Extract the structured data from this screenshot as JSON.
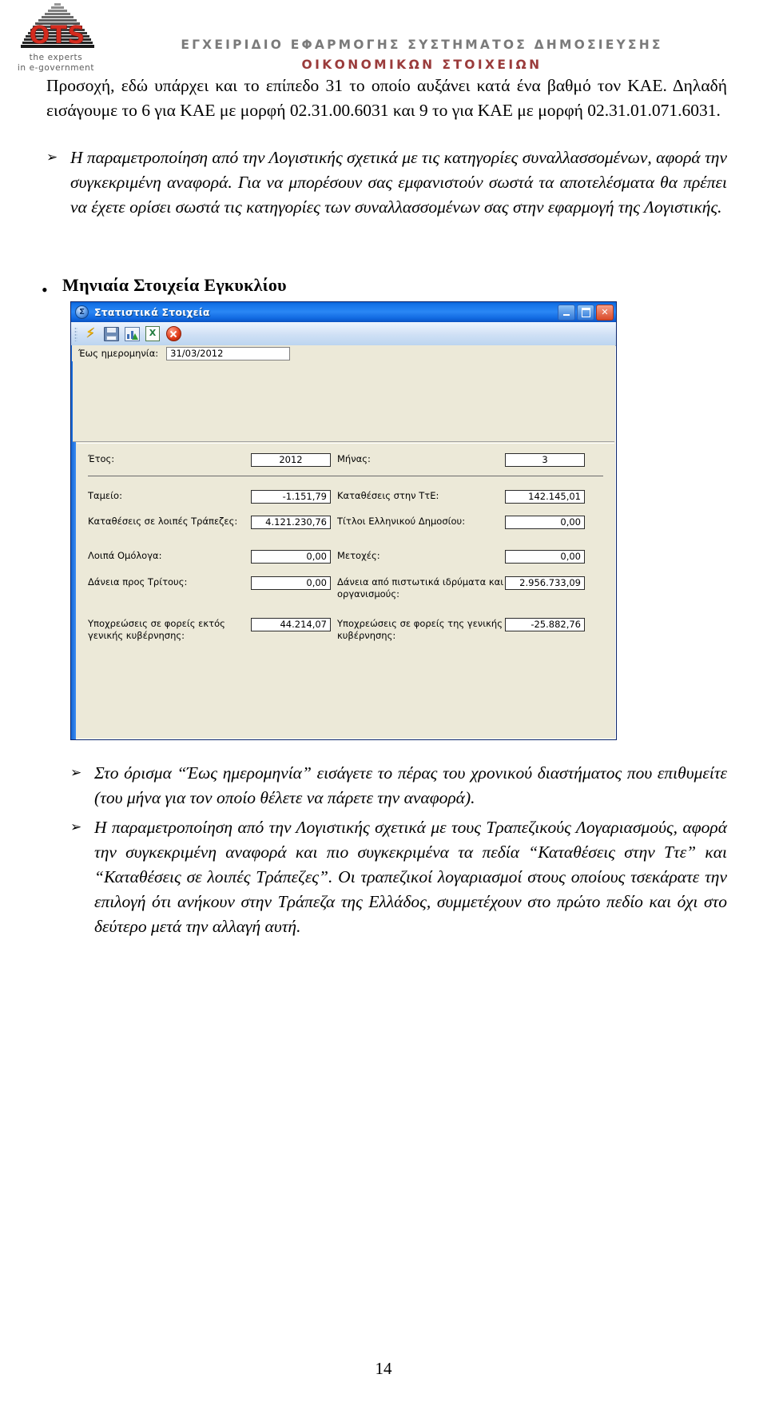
{
  "header": {
    "logo": {
      "brand": "OTS",
      "tagline_line1": "the experts",
      "tagline_line2": "in e-government"
    },
    "title_line1": "ΕΓΧΕΙΡΙΔΙΟ ΕΦΑΡΜΟΓΗΣ ΣΥΣΤΗΜΑΤΟΣ ΔΗΜΟΣΙΕΥΣΗΣ",
    "title_line2": "ΟΙΚΟΝΟΜΙΚΩΝ ΣΤΟΙΧΕΙΩΝ"
  },
  "body": {
    "intro_paragraph": "Προσοχή, εδώ υπάρχει και το επίπεδο 31 το οποίο αυξάνει κατά ένα βαθμό τον ΚΑΕ. Δηλαδή εισάγουμε το 6 για ΚΑΕ με μορφή 02.31.00.6031 και 9 το για ΚΑΕ με μορφή 02.31.01.071.6031.",
    "arrow_paragraph_1": "Η παραμετροποίηση από την Λογιστικής σχετικά με τις κατηγορίες συναλλασσομένων, αφορά την συγκεκριμένη αναφορά. Για να μπορέσουν σας εμφανιστούν σωστά τα αποτελέσματα θα πρέπει να έχετε ορίσει σωστά τις κατηγορίες των συναλλασσομένων σας στην εφαρμογή της Λογιστικής.",
    "section_bullet": "•",
    "section_heading": "Μηνιαία Στοιχεία Εγκυκλίου",
    "arrow_glyph": "➢",
    "footer_paragraph_1": "Στο όρισμα “Έως ημερομηνία” εισάγετε το πέρας του χρονικού διαστήματος που επιθυμείτε (του μήνα για τον οποίο θέλετε να πάρετε την αναφορά).",
    "footer_paragraph_2": "Η παραμετροποίηση από την Λογιστικής σχετικά με τους Τραπεζικούς Λογαριασμούς, αφορά την συγκεκριμένη αναφορά και πιο συγκεκριμένα τα πεδία “Καταθέσεις στην Ττε” και “Καταθέσεις σε λοιπές Τράπεζες”. Οι τραπεζικοί λογαριασμοί στους οποίους τσεκάρατε την επιλογή ότι ανήκουν στην Τράπεζα της Ελλάδος, συμμετέχουν στο πρώτο πεδίο και όχι στο δεύτερο μετά την αλλαγή αυτή.",
    "page_number": "14"
  },
  "app_window": {
    "title": "Στατιστικά Στοιχεία",
    "icon": "sigma-icon",
    "window_buttons": {
      "minimize": "minimize-icon",
      "maximize": "maximize-icon",
      "close": "close-icon"
    },
    "toolbar": [
      {
        "name": "execute-icon",
        "label": "Εκτέλεση"
      },
      {
        "name": "save-icon",
        "label": "Αποθήκευση"
      },
      {
        "name": "export-chart-icon",
        "label": "Εξαγωγή"
      },
      {
        "name": "export-excel-icon",
        "label": "Excel"
      },
      {
        "name": "close-icon",
        "label": "Κλείσιμο"
      }
    ],
    "filter": {
      "label": "Έως ημερομηνία:",
      "value": "31/03/2012"
    },
    "header_row": {
      "year_label": "Έτος:",
      "year_value": "2012",
      "month_label": "Μήνας:",
      "month_value": "3"
    },
    "fields": [
      {
        "left_label": "Ταμείο:",
        "left_value": "-1.151,79",
        "right_label": "Καταθέσεις στην ΤτΕ:",
        "right_value": "142.145,01"
      },
      {
        "left_label": "Καταθέσεις σε λοιπές Τράπεζες:",
        "left_value": "4.121.230,76",
        "right_label": "Τίτλοι Ελληνικού Δημοσίου:",
        "right_value": "0,00"
      },
      {
        "left_label": "Λοιπά Ομόλογα:",
        "left_value": "0,00",
        "right_label": "Μετοχές:",
        "right_value": "0,00"
      },
      {
        "left_label": "Δάνεια προς Τρίτους:",
        "left_value": "0,00",
        "right_label": "Δάνεια από πιστωτικά ιδρύματα και οργανισμούς:",
        "right_value": "2.956.733,09"
      },
      {
        "left_label": "Υποχρεώσεις σε φορείς εκτός γενικής κυβέρνησης:",
        "left_value": "44.214,07",
        "right_label": "Υποχρεώσεις σε φορείς της γενικής κυβέρνησης:",
        "right_value": "-25.882,76"
      }
    ]
  },
  "colors": {
    "title_grey": "#7a7a7a",
    "logo_red": "#d52b1e",
    "titlebar_blue": "#1573e8",
    "window_face": "#ece9d8"
  }
}
